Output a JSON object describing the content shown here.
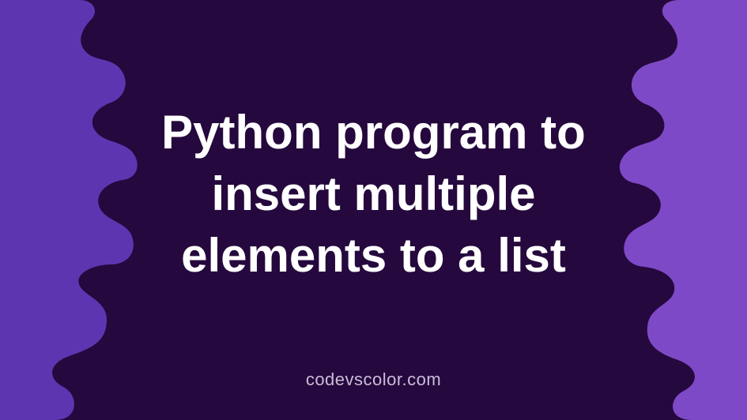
{
  "banner": {
    "title": "Python program to insert multiple elements to a list",
    "site_name": "codevscolor.com"
  },
  "colors": {
    "background_dark": "#25083d",
    "blob_left": "#5e35b1",
    "blob_right": "#7e49c7",
    "text": "#ffffff",
    "subtext": "#c9bdd8"
  }
}
